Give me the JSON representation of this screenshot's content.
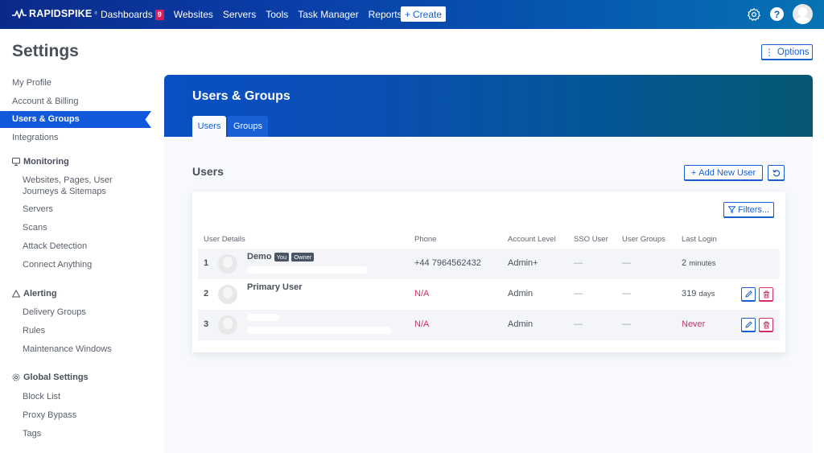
{
  "topnav": {
    "brand": "RAPIDSPIKE",
    "items": [
      {
        "label": "Dashboards",
        "badge": "9"
      },
      {
        "label": "Websites"
      },
      {
        "label": "Servers"
      },
      {
        "label": "Tools"
      },
      {
        "label": "Task Manager"
      },
      {
        "label": "Reports"
      }
    ],
    "create_label": "Create",
    "icons": [
      "gear-icon",
      "help-icon",
      "avatar"
    ],
    "help_glyph": "?"
  },
  "page": {
    "title": "Settings",
    "options_label": "Options"
  },
  "sidebar": {
    "top_items": [
      "My Profile",
      "Account & Billing",
      "Users & Groups",
      "Integrations"
    ],
    "active": "Users & Groups",
    "sections": [
      {
        "heading": "Monitoring",
        "icon": "monitor-icon",
        "items": [
          "Websites, Pages, User Journeys & Sitemaps",
          "Servers",
          "Scans",
          "Attack Detection",
          "Connect Anything"
        ]
      },
      {
        "heading": "Alerting",
        "icon": "warning-icon",
        "items": [
          "Delivery Groups",
          "Rules",
          "Maintenance Windows"
        ]
      },
      {
        "heading": "Global Settings",
        "icon": "gear-icon",
        "items": [
          "Block List",
          "Proxy Bypass",
          "Tags"
        ]
      }
    ],
    "websites_line1": "Websites, Pages, User",
    "websites_line2": "Journeys & Sitemaps"
  },
  "main": {
    "title": "Users & Groups",
    "tabs": [
      {
        "label": "Users",
        "active": true
      },
      {
        "label": "Groups",
        "active": false
      }
    ],
    "section_title": "Users",
    "add_user_label": "Add New User",
    "filters_label": "Filters...",
    "table": {
      "headers": [
        "User Details",
        "Phone",
        "Account Level",
        "SSO User",
        "User Groups",
        "Last Login"
      ],
      "rows": [
        {
          "index": "1",
          "name": "Demo",
          "tags": [
            "You",
            "Owner"
          ],
          "phone": "+44 7964562432",
          "level": "Admin+",
          "sso": "—",
          "groups": "—",
          "last_login_num": "2",
          "last_login_unit": "minutes",
          "actions": false
        },
        {
          "index": "2",
          "name": "Primary User",
          "tags": [],
          "phone": "N/A",
          "level": "Admin",
          "sso": "—",
          "groups": "—",
          "last_login_num": "319",
          "last_login_unit": "days",
          "actions": true
        },
        {
          "index": "3",
          "name": "",
          "tags": [],
          "phone": "N/A",
          "level": "Admin",
          "sso": "—",
          "groups": "—",
          "last_login_num": "Never",
          "last_login_unit": "",
          "actions": true
        }
      ]
    }
  },
  "colors": {
    "accent": "#1a5fd0",
    "active_sidebar": "#1158db",
    "danger": "#d0306a",
    "badge": "#d61f5a"
  }
}
